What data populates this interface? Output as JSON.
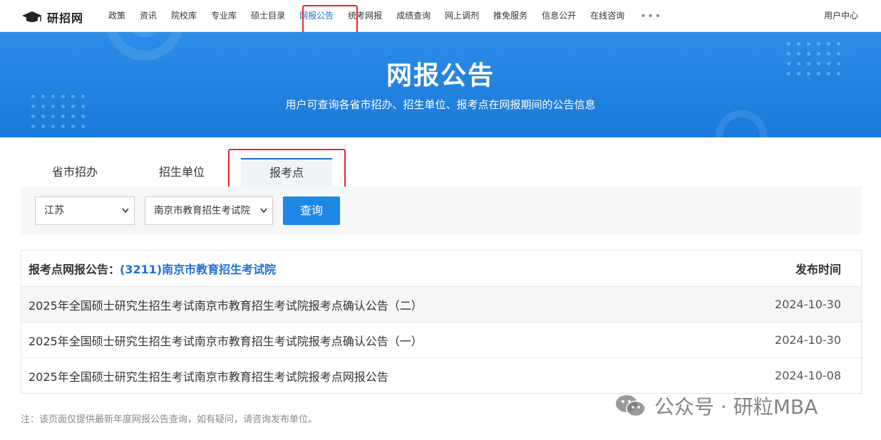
{
  "header": {
    "logo_text": "研招网",
    "nav": [
      "政策",
      "资讯",
      "院校库",
      "专业库",
      "硕士目录",
      "网报公告",
      "统考网报",
      "成绩查询",
      "网上调剂",
      "推免服务",
      "信息公开",
      "在线咨询"
    ],
    "active_index": 5,
    "more_label": "•••",
    "user_center": "用户中心"
  },
  "banner": {
    "title": "网报公告",
    "subtitle": "用户可查询各省市招办、招生单位、报考点在网报期间的公告信息"
  },
  "tabs": [
    "省市招办",
    "招生单位",
    "报考点"
  ],
  "active_tab": 2,
  "filter": {
    "province": "江苏",
    "site": "南京市教育招生考试院",
    "query_label": "查询"
  },
  "table": {
    "head_label": "报考点网报公告：",
    "head_unit": "(3211)南京市教育招生考试院",
    "head_date": "发布时间",
    "rows": [
      {
        "title": "2025年全国硕士研究生招生考试南京市教育招生考试院报考点确认公告（二）",
        "date": "2024-10-30"
      },
      {
        "title": "2025年全国硕士研究生招生考试南京市教育招生考试院报考点确认公告（一）",
        "date": "2024-10-30"
      },
      {
        "title": "2025年全国硕士研究生招生考试南京市教育招生考试院报考点网报公告",
        "date": "2024-10-08"
      }
    ]
  },
  "note": "注：该页面仅提供最新年度网报公告查询，如有疑问，请咨询发布单位。",
  "watermark": "公众号 · 研粒MBA",
  "colors": {
    "accent": "#1e6fd9",
    "banner": "#1f83e0",
    "highlight": "#e8262e"
  }
}
